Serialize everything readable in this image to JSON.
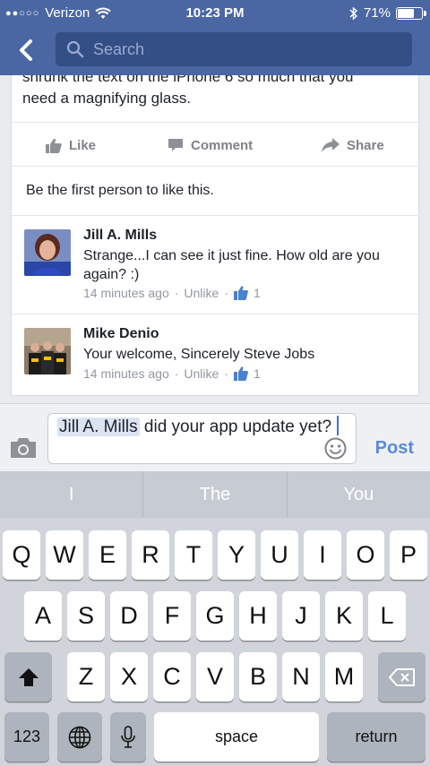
{
  "status": {
    "carrier": "Verizon",
    "time": "10:23 PM",
    "battery": "71%",
    "battery_level": 0.71
  },
  "search": {
    "placeholder": "Search"
  },
  "post": {
    "text_line1": "shrunk the text on the iPhone 6 so much that you",
    "text_line2": "need a magnifying glass."
  },
  "actions": {
    "like": "Like",
    "comment": "Comment",
    "share": "Share"
  },
  "likes_line": "Be the first person to like this.",
  "comments": [
    {
      "name": "Jill A. Mills",
      "text": "Strange...I can see it just fine. How old are you again? :)",
      "time": "14 minutes ago",
      "sep1": "·",
      "unlike": "Unlike",
      "sep2": "·",
      "likes": "1"
    },
    {
      "name": "Mike Denio",
      "text": "Your welcome, Sincerely Steve Jobs",
      "time": "14 minutes ago",
      "sep1": "·",
      "unlike": "Unlike",
      "sep2": "·",
      "likes": "1"
    }
  ],
  "composer": {
    "tag": "Jill A. Mills",
    "text": " did your app update yet?",
    "post_label": "Post"
  },
  "keyboard": {
    "suggestions": [
      "I",
      "The",
      "You"
    ],
    "row1": [
      "Q",
      "W",
      "E",
      "R",
      "T",
      "Y",
      "U",
      "I",
      "O",
      "P"
    ],
    "row2": [
      "A",
      "S",
      "D",
      "F",
      "G",
      "H",
      "J",
      "K",
      "L"
    ],
    "row3": [
      "Z",
      "X",
      "C",
      "V",
      "B",
      "N",
      "M"
    ],
    "numbers_label": "123",
    "space_label": "space",
    "return_label": "return"
  },
  "colors": {
    "brand_blue": "#4a67a4",
    "post_blue": "#5b8ad8",
    "like_blue": "#4a80d0"
  }
}
